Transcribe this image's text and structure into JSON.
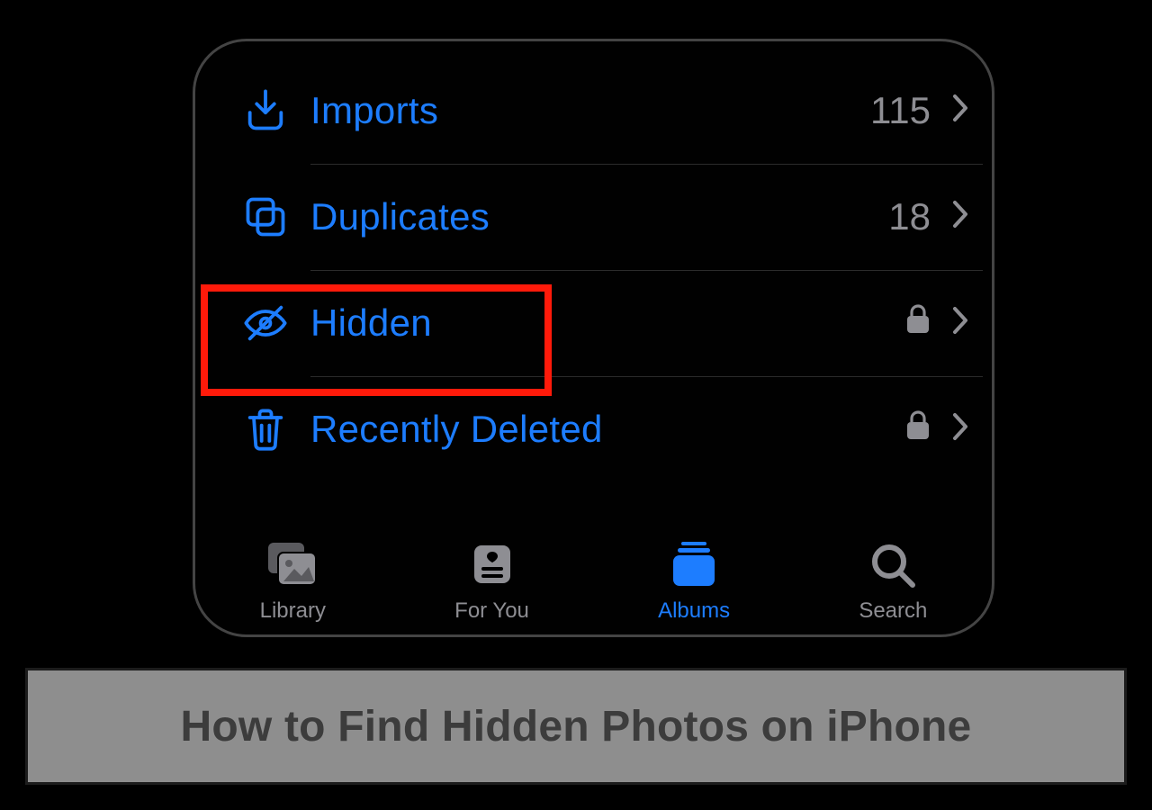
{
  "colors": {
    "accent": "#1d7dff",
    "muted": "#8e8e93",
    "highlight": "#ff1a0a"
  },
  "albums": {
    "rows": [
      {
        "icon": "import-icon",
        "label": "Imports",
        "count": "115",
        "locked": false
      },
      {
        "icon": "duplicates-icon",
        "label": "Duplicates",
        "count": "18",
        "locked": false
      },
      {
        "icon": "hidden-eye-icon",
        "label": "Hidden",
        "count": "",
        "locked": true
      },
      {
        "icon": "trash-icon",
        "label": "Recently Deleted",
        "count": "",
        "locked": true
      }
    ]
  },
  "tabs": [
    {
      "icon": "library-icon",
      "label": "Library",
      "active": false
    },
    {
      "icon": "foryou-icon",
      "label": "For You",
      "active": false
    },
    {
      "icon": "albums-icon",
      "label": "Albums",
      "active": true
    },
    {
      "icon": "search-icon",
      "label": "Search",
      "active": false
    }
  ],
  "caption": "How to Find Hidden Photos on iPhone"
}
